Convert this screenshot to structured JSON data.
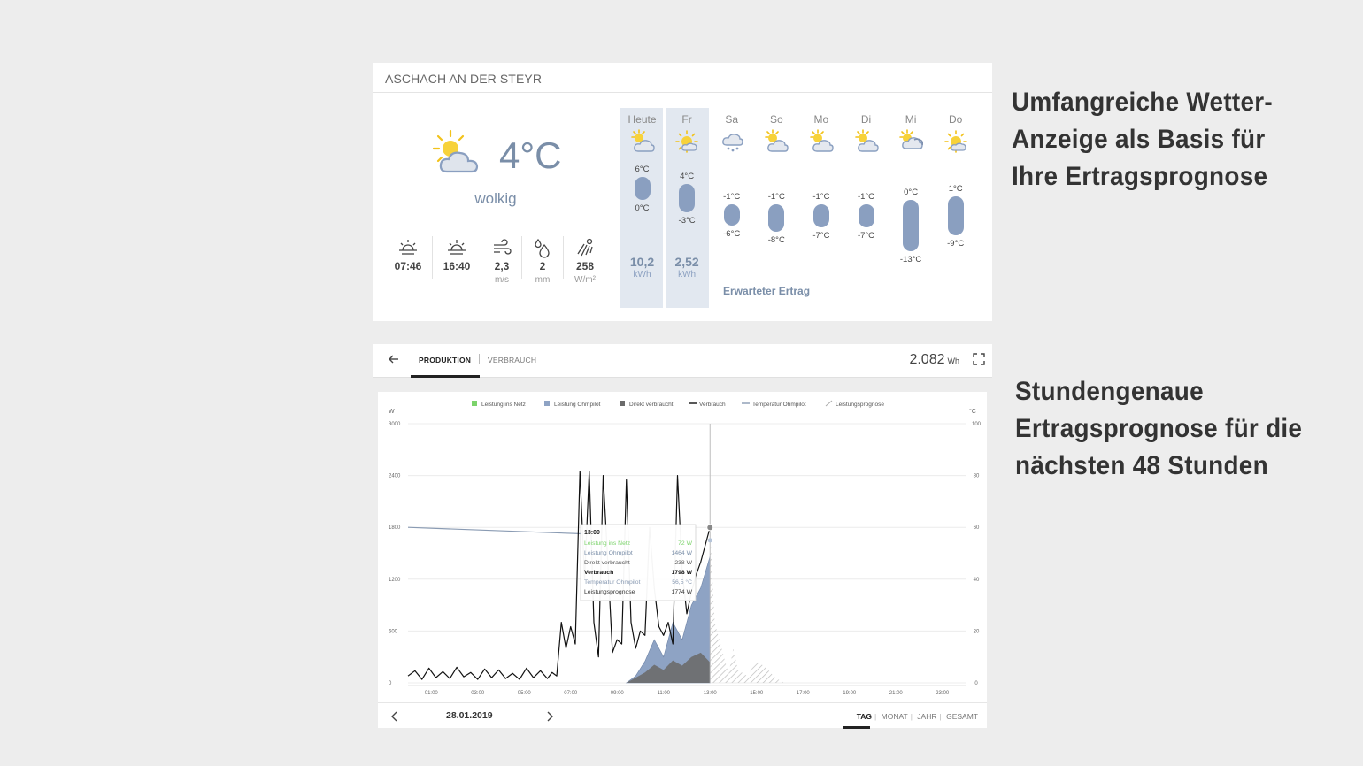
{
  "weather": {
    "location": "ASCHACH AN DER STEYR",
    "current": {
      "temperature": "4°C",
      "description": "wolkig",
      "stats": [
        {
          "icon": "sunrise-icon",
          "value": "07:46",
          "unit": ""
        },
        {
          "icon": "sunset-icon",
          "value": "16:40",
          "unit": ""
        },
        {
          "icon": "wind-icon",
          "value": "2,3",
          "unit": "m/s"
        },
        {
          "icon": "raindrops-icon",
          "value": "2",
          "unit": "mm"
        },
        {
          "icon": "solar-radiation-icon",
          "value": "258",
          "unit": "W/m²"
        }
      ]
    },
    "forecast": [
      {
        "day": "Heute",
        "icon": "sun-cloud-icon",
        "max": "6°C",
        "min": "0°C",
        "max_c": 6,
        "min_c": 0,
        "yield": "10,2",
        "yield_unit": "kWh"
      },
      {
        "day": "Fr",
        "icon": "sun-icon",
        "max": "4°C",
        "min": "-3°C",
        "max_c": 4,
        "min_c": -3,
        "yield": "2,52",
        "yield_unit": "kWh"
      },
      {
        "day": "Sa",
        "icon": "snow-cloud-icon",
        "max": "-1°C",
        "min": "-6°C",
        "max_c": -1,
        "min_c": -6
      },
      {
        "day": "So",
        "icon": "sun-cloud-icon",
        "max": "-1°C",
        "min": "-8°C",
        "max_c": -1,
        "min_c": -8
      },
      {
        "day": "Mo",
        "icon": "sun-cloud-icon",
        "max": "-1°C",
        "min": "-7°C",
        "max_c": -1,
        "min_c": -7
      },
      {
        "day": "Di",
        "icon": "sun-cloud-icon",
        "max": "-1°C",
        "min": "-7°C",
        "max_c": -1,
        "min_c": -7
      },
      {
        "day": "Mi",
        "icon": "sun-rain-cloud-icon",
        "max": "0°C",
        "min": "-13°C",
        "max_c": 0,
        "min_c": -13
      },
      {
        "day": "Do",
        "icon": "sun-icon",
        "max": "1°C",
        "min": "-9°C",
        "max_c": 1,
        "min_c": -9
      }
    ],
    "expected_yield_label": "Erwarteter Ertrag"
  },
  "captions": {
    "top": [
      "Umfangreiche Wetter-",
      "Anzeige als Basis für",
      "Ihre Ertragsprognose"
    ],
    "bottom": [
      "Stundengenaue",
      "Ertragsprognose für die",
      "nächsten 48 Stunden"
    ]
  },
  "chart_header": {
    "tab_production": "PRODUKTION",
    "tab_consumption": "VERBRAUCH",
    "total_value": "2.082",
    "total_unit": "Wh"
  },
  "chart_footer": {
    "date": "28.01.2019",
    "periods": [
      "TAG",
      "MONAT",
      "JAHR",
      "GESAMT"
    ],
    "active_period": "TAG"
  },
  "colors": {
    "accent": "#7a8ea8",
    "grid_feed": "#7cd36b",
    "ohmpilot": "#8ea3c4",
    "direct": "#6b6b6b",
    "consumption": "#111111",
    "temperature": "#8a9bb3",
    "forecast": "#c8c8c8"
  },
  "chart_data": {
    "type": "line",
    "legend": [
      "Leistung ins Netz",
      "Leistung Ohmpilot",
      "Direkt verbraucht",
      "Verbrauch",
      "Temperatur Ohmpilot",
      "Leistungsprognose"
    ],
    "ylabel_left": "W",
    "ylabel_right": "°C",
    "y_left_ticks": [
      "3000",
      "2400",
      "1800",
      "1200",
      "600",
      "0"
    ],
    "y_right_ticks": [
      "100",
      "80",
      "60",
      "40",
      "20",
      "0"
    ],
    "ylim_left": [
      0,
      3000
    ],
    "ylim_right": [
      0,
      100
    ],
    "x_ticks": [
      "01:00",
      "03:00",
      "05:00",
      "07:00",
      "09:00",
      "11:00",
      "13:00",
      "15:00",
      "17:00",
      "19:00",
      "21:00",
      "23:00"
    ],
    "xlim": [
      0,
      24
    ],
    "cursor_time": 13,
    "series": [
      {
        "name": "Verbrauch",
        "kind": "line",
        "x": [
          0,
          0.3,
          0.6,
          0.9,
          1.2,
          1.5,
          1.8,
          2.1,
          2.4,
          2.7,
          3,
          3.3,
          3.6,
          3.9,
          4.2,
          4.5,
          4.8,
          5.1,
          5.4,
          5.7,
          6,
          6.2,
          6.4,
          6.6,
          6.8,
          7,
          7.2,
          7.4,
          7.6,
          7.8,
          8,
          8.2,
          8.4,
          8.6,
          8.8,
          9,
          9.2,
          9.4,
          9.6,
          9.8,
          10,
          10.2,
          10.4,
          10.6,
          10.8,
          11,
          11.2,
          11.4,
          11.6,
          11.8,
          12,
          12.2,
          12.4,
          12.6,
          12.8,
          13
        ],
        "y": [
          80,
          140,
          40,
          170,
          60,
          130,
          50,
          180,
          70,
          120,
          40,
          160,
          60,
          150,
          50,
          110,
          40,
          170,
          60,
          140,
          50,
          120,
          80,
          700,
          400,
          650,
          450,
          2450,
          1200,
          2450,
          700,
          300,
          2400,
          1400,
          350,
          500,
          450,
          2350,
          700,
          400,
          600,
          550,
          1800,
          1100,
          650,
          550,
          700,
          450,
          2400,
          1300,
          800,
          1050,
          1250,
          1400,
          1600,
          1798
        ]
      },
      {
        "name": "Leistung Ohmpilot",
        "kind": "area",
        "x": [
          9.4,
          9.8,
          10.2,
          10.6,
          11,
          11.4,
          11.8,
          12.2,
          12.6,
          13
        ],
        "y": [
          0,
          80,
          250,
          500,
          300,
          700,
          500,
          900,
          1100,
          1464
        ]
      },
      {
        "name": "Direkt verbraucht",
        "kind": "area",
        "x": [
          9.4,
          9.8,
          10.2,
          10.6,
          11,
          11.4,
          11.8,
          12.2,
          12.6,
          13
        ],
        "y": [
          0,
          60,
          120,
          210,
          150,
          260,
          200,
          300,
          350,
          238
        ]
      },
      {
        "name": "Temperatur Ohmpilot",
        "kind": "line",
        "axis": "right",
        "x": [
          0,
          7.5
        ],
        "y": [
          60,
          57.5
        ]
      },
      {
        "name": "Leistungsprognose",
        "kind": "hatched",
        "x": [
          13,
          13.2,
          13.4,
          13.6,
          13.8,
          14,
          14.2,
          14.6,
          15,
          15.4,
          15.8,
          16.2
        ],
        "y": [
          1774,
          700,
          500,
          300,
          100,
          400,
          150,
          80,
          250,
          180,
          60,
          0
        ]
      }
    ],
    "tooltip": {
      "time": "13:00",
      "rows": [
        {
          "label": "Leistung ins Netz",
          "value": "72 W"
        },
        {
          "label": "Leistung Ohmpilot",
          "value": "1464 W"
        },
        {
          "label": "Direkt verbraucht",
          "value": "238 W"
        },
        {
          "label": "Verbrauch",
          "value": "1798 W"
        },
        {
          "label": "Temperatur Ohmpilot",
          "value": "56,5 °C"
        },
        {
          "label": "Leistungsprognose",
          "value": "1774 W"
        }
      ]
    }
  }
}
